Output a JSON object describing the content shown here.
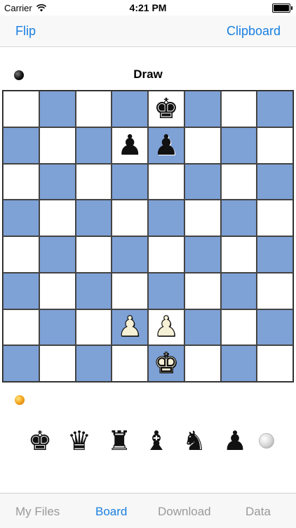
{
  "status_bar": {
    "carrier": "Carrier",
    "time": "4:21 PM"
  },
  "nav": {
    "left_label": "Flip",
    "right_label": "Clipboard"
  },
  "game": {
    "status": "Draw"
  },
  "board": {
    "rows": [
      [
        "",
        "",
        "",
        "",
        "k",
        "",
        "",
        ""
      ],
      [
        "",
        "",
        "",
        "p",
        "p",
        "",
        "",
        ""
      ],
      [
        "",
        "",
        "",
        "",
        "",
        "",
        "",
        ""
      ],
      [
        "",
        "",
        "",
        "",
        "",
        "",
        "",
        ""
      ],
      [
        "",
        "",
        "",
        "",
        "",
        "",
        "",
        ""
      ],
      [
        "",
        "",
        "",
        "",
        "",
        "",
        "",
        ""
      ],
      [
        "",
        "",
        "",
        "P",
        "P",
        "",
        "",
        ""
      ],
      [
        "",
        "",
        "",
        "",
        "K",
        "",
        "",
        ""
      ]
    ],
    "light_color": "#ffffff",
    "dark_color": "#7ea1d6"
  },
  "palette": {
    "pieces": [
      "king",
      "queen",
      "rook",
      "bishop",
      "knight",
      "pawn"
    ],
    "glyphs": [
      "♚",
      "♛",
      "♜",
      "♝",
      "♞",
      "♟"
    ]
  },
  "tabs": [
    {
      "label": "My Files",
      "active": false
    },
    {
      "label": "Board",
      "active": true
    },
    {
      "label": "Download",
      "active": false
    },
    {
      "label": "Data",
      "active": false
    }
  ],
  "colors": {
    "accent": "#1a7fe0",
    "inactive_tab": "#9a9a9a"
  }
}
